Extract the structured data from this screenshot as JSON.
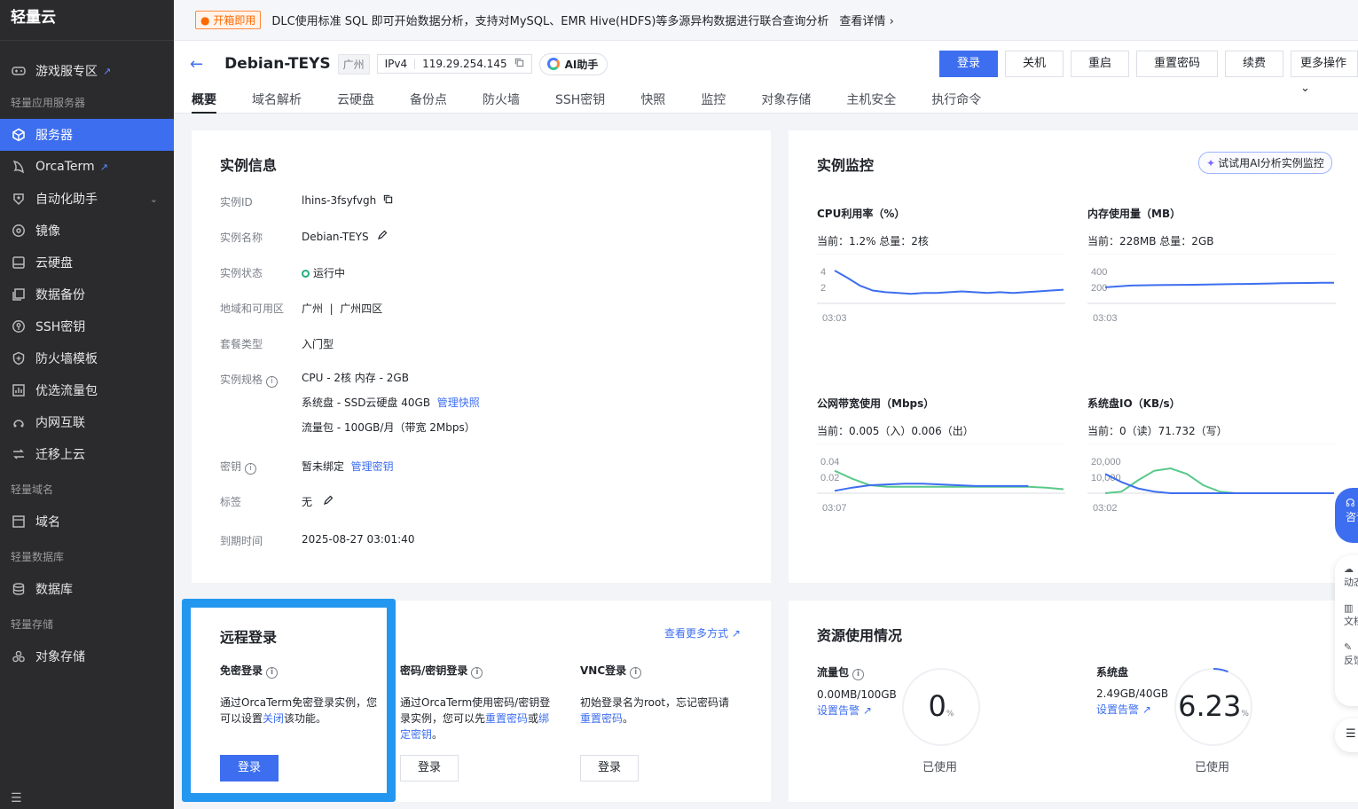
{
  "sidebar": {
    "brand": "轻量云",
    "game": "游戏服专区",
    "sec_lighthouse": "轻量应用服务器",
    "server": "服务器",
    "orcaterm": "OrcaTerm",
    "automation": "自动化助手",
    "image": "镜像",
    "disk": "云硬盘",
    "backup": "数据备份",
    "ssh": "SSH密钥",
    "firewall": "防火墙模板",
    "traffic": "优选流量包",
    "intranet": "内网互联",
    "migrate": "迁移上云",
    "sec_domain": "轻量域名",
    "domain": "域名",
    "sec_db": "轻量数据库",
    "database": "数据库",
    "sec_storage": "轻量存储",
    "object_storage": "对象存储"
  },
  "banner": {
    "tag": "开箱即用",
    "message": "DLC使用标准 SQL 即可开始数据分析，支持对MySQL、EMR Hive(HDFS)等多源异构数据进行联合查询分析",
    "more": "查看详情"
  },
  "header": {
    "instance_name": "Debian-TEYS",
    "region": "广州",
    "ip_type": "IPv4",
    "ip": "119.29.254.145",
    "ai_assistant": "AI助手",
    "actions": {
      "login": "登录",
      "shutdown": "关机",
      "restart": "重启",
      "reset_password": "重置密码",
      "renew": "续费",
      "more": "更多操作"
    },
    "tabs": [
      "概要",
      "域名解析",
      "云硬盘",
      "备份点",
      "防火墙",
      "SSH密钥",
      "快照",
      "监控",
      "对象存储",
      "主机安全",
      "执行命令"
    ]
  },
  "info": {
    "title": "实例信息",
    "id_label": "实例ID",
    "id": "lhins-3fsyfvgh",
    "name_label": "实例名称",
    "name": "Debian-TEYS",
    "status_label": "实例状态",
    "status": "运行中",
    "zone_label": "地域和可用区",
    "zone": "广州  |  广州四区",
    "plan_label": "套餐类型",
    "plan": "入门型",
    "spec_label": "实例规格",
    "spec_cpu": "CPU - 2核 内存 - 2GB",
    "spec_disk": "系统盘 - SSD云硬盘 40GB",
    "spec_disk_link": "管理快照",
    "spec_traffic": "流量包 - 100GB/月（带宽 2Mbps）",
    "key_label": "密钥",
    "key": "暂未绑定",
    "key_link": "管理密钥",
    "tag_label": "标签",
    "tag": "无",
    "expire_label": "到期时间",
    "expire": "2025-08-27 03:01:40"
  },
  "monitor": {
    "title": "实例监控",
    "ai_analyze": "试试用AI分析实例监控",
    "cpu_title": "CPU利用率（%）",
    "cpu_now": "当前：1.2% 总量：2核",
    "mem_title": "内存使用量（MB）",
    "mem_now": "当前：228MB 总量：2GB",
    "bw_title": "公网带宽使用（Mbps）",
    "bw_now": "当前：0.005（入）0.006（出）",
    "io_title": "系统盘IO（KB/s）",
    "io_now": "当前：0（读）71.732（写）"
  },
  "chart_data": [
    {
      "type": "line",
      "title": "CPU利用率（%）",
      "y_ticks": [
        "4",
        "2"
      ],
      "x_ticks": [
        "03:03"
      ],
      "series": [
        {
          "values": [
            4.1,
            3.2,
            2.2,
            1.6,
            1.4,
            1.3,
            1.2,
            1.3,
            1.3,
            1.4,
            1.5,
            1.4,
            1.3,
            1.4,
            1.3,
            1.4,
            1.5,
            1.6,
            1.7
          ],
          "color": "#3d6ef0"
        }
      ]
    },
    {
      "type": "line",
      "title": "内存使用量（MB）",
      "y_ticks": [
        "400",
        "200"
      ],
      "x_ticks": [
        "03:03"
      ],
      "series": [
        {
          "values": [
            200,
            212,
            222,
            226,
            228,
            230,
            231,
            233,
            236,
            238,
            240,
            242,
            245,
            248,
            251,
            253,
            255,
            257,
            258
          ],
          "color": "#3d6ef0"
        }
      ]
    },
    {
      "type": "line",
      "title": "公网带宽使用（Mbps）",
      "y_ticks": [
        "0.04",
        "0.02"
      ],
      "x_ticks": [
        "03:07"
      ],
      "series": [
        {
          "values": [
            0.028,
            0.018,
            0.01,
            0.008,
            0.008,
            0.008,
            0.008,
            0.008,
            0.008,
            0.008,
            0.008,
            0.008,
            0.007,
            0.005
          ],
          "color": "#58c98a"
        },
        {
          "values": [
            0.003,
            0.007,
            0.01,
            0.011,
            0.012,
            0.012,
            0.011,
            0.01,
            0.009,
            0.009,
            0.009,
            0.009
          ],
          "color": "#3d6ef0"
        }
      ]
    },
    {
      "type": "line",
      "title": "系统盘IO（KB/s）",
      "y_ticks": [
        "20,000",
        "10,000"
      ],
      "x_ticks": [
        "03:02"
      ],
      "series": [
        {
          "values": [
            0,
            1000,
            8000,
            14000,
            15500,
            12000,
            5000,
            1000,
            0,
            0,
            0,
            0,
            0,
            0,
            0
          ],
          "color": "#58c98a"
        },
        {
          "values": [
            12000,
            7000,
            3000,
            1000,
            0,
            0,
            0,
            0,
            0,
            0,
            0,
            0,
            0,
            0,
            0
          ],
          "color": "#3d6ef0"
        }
      ]
    }
  ],
  "login": {
    "title": "远程登录",
    "more_ways": "查看更多方式",
    "free_title": "免密登录",
    "free_desc_1": "通过OrcaTerm免密登录实例，您可以设置",
    "free_desc_link": "关闭",
    "free_desc_2": "该功能。",
    "pwd_title": "密码/密钥登录",
    "pwd_desc_1": "通过OrcaTerm使用密码/密钥登录实例，您可以先",
    "pwd_desc_link1": "重置密码",
    "pwd_desc_mid": "或",
    "pwd_desc_link2": "绑定密钥",
    "pwd_desc_end": "。",
    "vnc_title": "VNC登录",
    "vnc_desc_1": "初始登录名为root，忘记密码请",
    "vnc_desc_link": "重置密码",
    "vnc_desc_end": "。",
    "btn": "登录"
  },
  "resource": {
    "title": "资源使用情况",
    "traffic_title": "流量包",
    "traffic_value": "0.00MB/100GB",
    "traffic_alert": "设置告警",
    "traffic_percent": "0",
    "traffic_percent_value": 0,
    "disk_title": "系统盘",
    "disk_value": "2.49GB/40GB",
    "disk_alert": "设置告警",
    "disk_percent": "6.23",
    "disk_percent_value": 6.23,
    "percent_unit": "%",
    "used": "已使用"
  },
  "float": {
    "consult": "咨询",
    "dynamic": "动态",
    "docs": "文档",
    "feedback": "反馈"
  }
}
